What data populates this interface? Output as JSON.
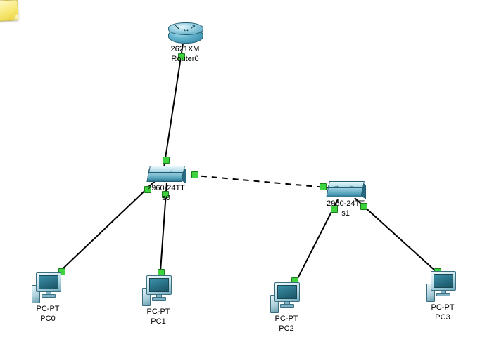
{
  "devices": {
    "router0": {
      "model": "2621XM",
      "hostname": "Router0"
    },
    "switch0": {
      "model": "2960-24TT",
      "hostname": "s0"
    },
    "switch1": {
      "model": "2960-24TT",
      "hostname": "s1"
    },
    "pc0": {
      "model": "PC-PT",
      "hostname": "PC0"
    },
    "pc1": {
      "model": "PC-PT",
      "hostname": "PC1"
    },
    "pc2": {
      "model": "PC-PT",
      "hostname": "PC2"
    },
    "pc3": {
      "model": "PC-PT",
      "hostname": "PC3"
    }
  },
  "links": [
    {
      "from": "router0",
      "to": "switch0",
      "style": "solid",
      "status": [
        "up",
        "up"
      ]
    },
    {
      "from": "switch0",
      "to": "switch1",
      "style": "dashed",
      "status": [
        "up",
        "up"
      ]
    },
    {
      "from": "switch0",
      "to": "pc0",
      "style": "solid",
      "status": [
        "up",
        "up"
      ]
    },
    {
      "from": "switch0",
      "to": "pc1",
      "style": "solid",
      "status": [
        "up",
        "up"
      ]
    },
    {
      "from": "switch1",
      "to": "pc2",
      "style": "solid",
      "status": [
        "up",
        "up"
      ]
    },
    {
      "from": "switch1",
      "to": "pc3",
      "style": "solid",
      "status": [
        "up",
        "up"
      ]
    }
  ],
  "colors": {
    "link_up": "#3fd23f",
    "device_body": "#5ba6c0"
  }
}
